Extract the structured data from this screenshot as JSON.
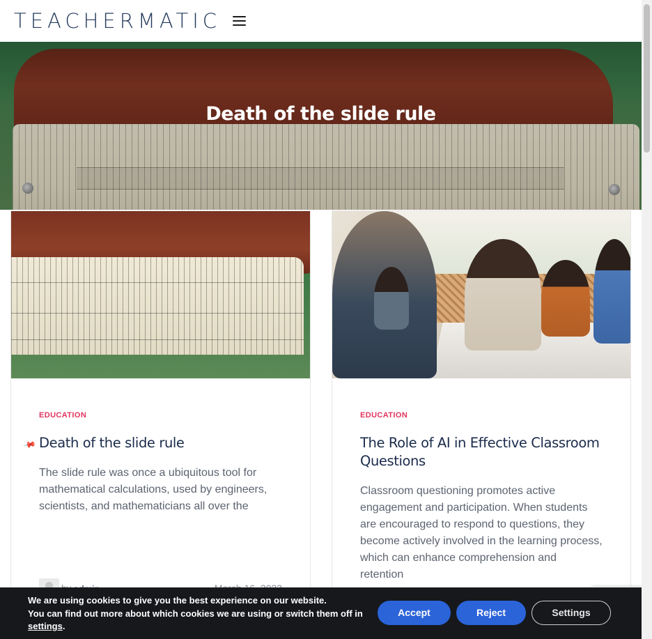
{
  "header": {
    "logo": "TEACHERMATIC",
    "menu_icon": "hamburger-menu-icon"
  },
  "hero": {
    "title": "Death of the slide rule"
  },
  "posts": [
    {
      "category": "EDUCATION",
      "title": "Death of the slide rule",
      "sticky_icon": "pin-icon",
      "excerpt": "The slide rule was once a ubiquitous tool for mathematical calculations, used by engineers, scientists, and mathematicians all over the",
      "by": "by",
      "author": "admin",
      "date": "March 16, 2023"
    },
    {
      "category": "EDUCATION",
      "title": "The Role of AI in Effective Classroom Questions",
      "excerpt": "Classroom questioning promotes active engagement and participation. When students are encouraged to respond to questions, they become actively involved in the learning process, which can enhance comprehension and retention"
    }
  ],
  "cookie_bar": {
    "line1": "We are using cookies to give you the best experience on our website.",
    "line2": "You can find out more about which cookies we are using or switch them off in",
    "link": "settings",
    "after_link": ".",
    "accept": "Accept",
    "reject": "Reject",
    "settings": "Settings"
  },
  "colors": {
    "accent": "#e0335e",
    "title": "#1b2b4b",
    "button": "#2b63d9",
    "cookie_bg": "#16181c"
  }
}
